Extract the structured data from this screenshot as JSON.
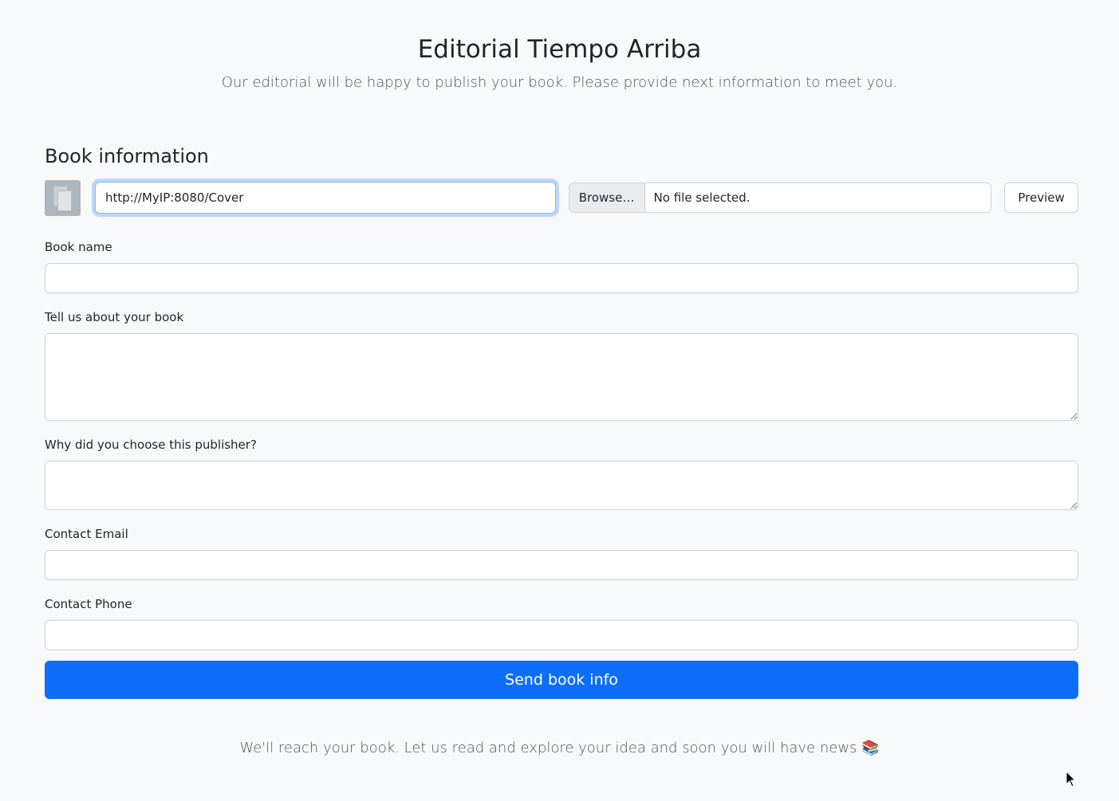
{
  "header": {
    "title": "Editorial Tiempo Arriba",
    "subtitle": "Our editorial will be happy to publish your book. Please provide next information to meet you."
  },
  "book_section": {
    "title": "Book information",
    "cover_url_value": "http://MyIP:8080/Cover",
    "browse_label": "Browse…",
    "file_status": "No file selected.",
    "preview_label": "Preview"
  },
  "fields": {
    "book_name_label": "Book name",
    "about_label": "Tell us about your book",
    "why_label": "Why did you choose this publisher?",
    "email_label": "Contact Email",
    "phone_label": "Contact Phone"
  },
  "send_label": "Send book info",
  "footer_text": "We'll reach your book. Let us read and explore your idea and soon you will have news 📚",
  "colors": {
    "primary": "#0d6efd",
    "background": "#f8f9fa",
    "focus_border": "#86b7fe"
  }
}
